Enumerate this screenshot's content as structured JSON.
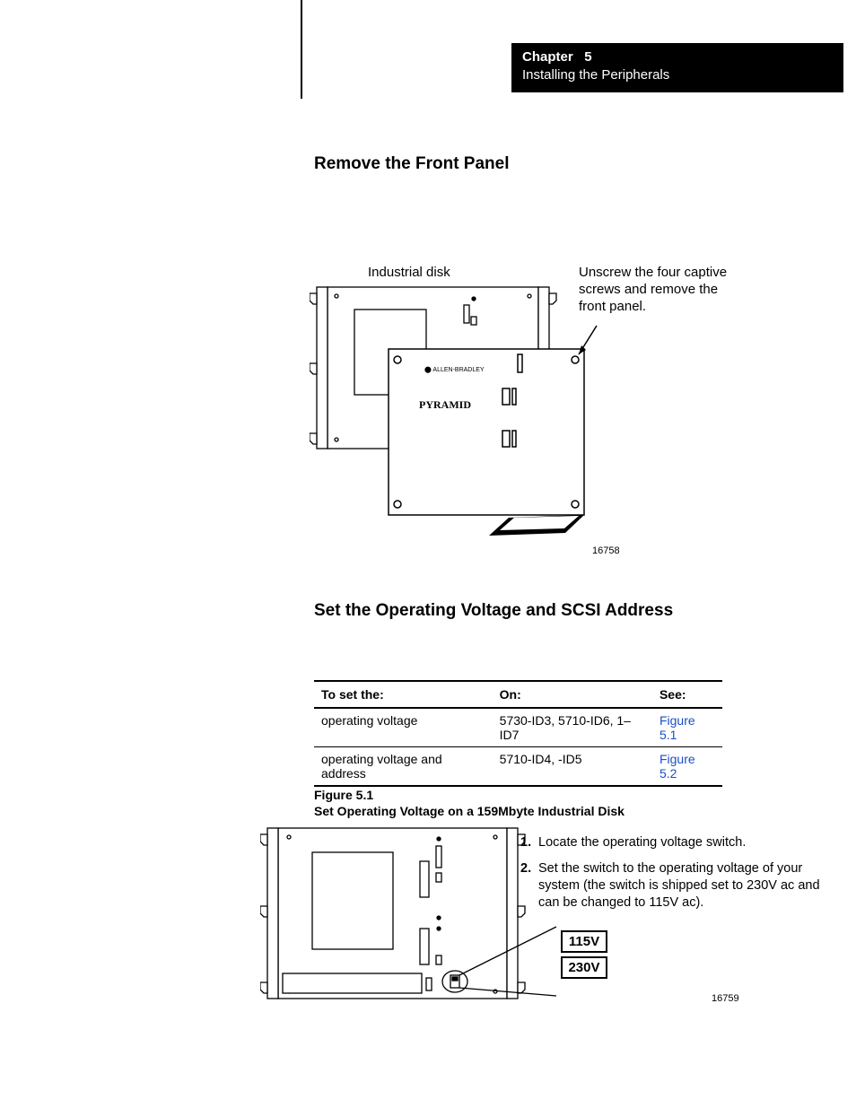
{
  "chapter": {
    "label": "Chapter",
    "number": "5",
    "subtitle": "Installing the Peripherals"
  },
  "headings": {
    "remove_panel": "Remove the Front Panel",
    "set_voltage_scsi": "Set the Operating Voltage and SCSI Address"
  },
  "fig1": {
    "label_industrial": "Industrial disk",
    "label_unscrew": "Unscrew the four captive screws and remove the front panel.",
    "brand_ab": "ALLEN-BRADLEY",
    "brand_pyramid": "PYRAMID",
    "id": "16758"
  },
  "table": {
    "headers": {
      "c1": "To set the:",
      "c2": "On:",
      "c3": "See:"
    },
    "rows": [
      {
        "c1": "operating voltage",
        "c2": "5730-ID3, 5710-ID6, 1–ID7",
        "c3": "Figure 5.1"
      },
      {
        "c1": "operating voltage and address",
        "c2": "5710-ID4, -ID5",
        "c3": "Figure 5.2"
      }
    ]
  },
  "fig2": {
    "figlabel": "Figure 5.1",
    "figtitle": "Set Operating Voltage on a 159Mbyte Industrial Disk",
    "steps": [
      {
        "n": "1.",
        "t": "Locate the operating voltage switch."
      },
      {
        "n": "2.",
        "t": "Set the switch to the operating voltage of your system (the switch is shipped set to 230V ac and can be changed to 115V ac)."
      }
    ],
    "v115": "115V",
    "v230": "230V",
    "id": "16759"
  }
}
